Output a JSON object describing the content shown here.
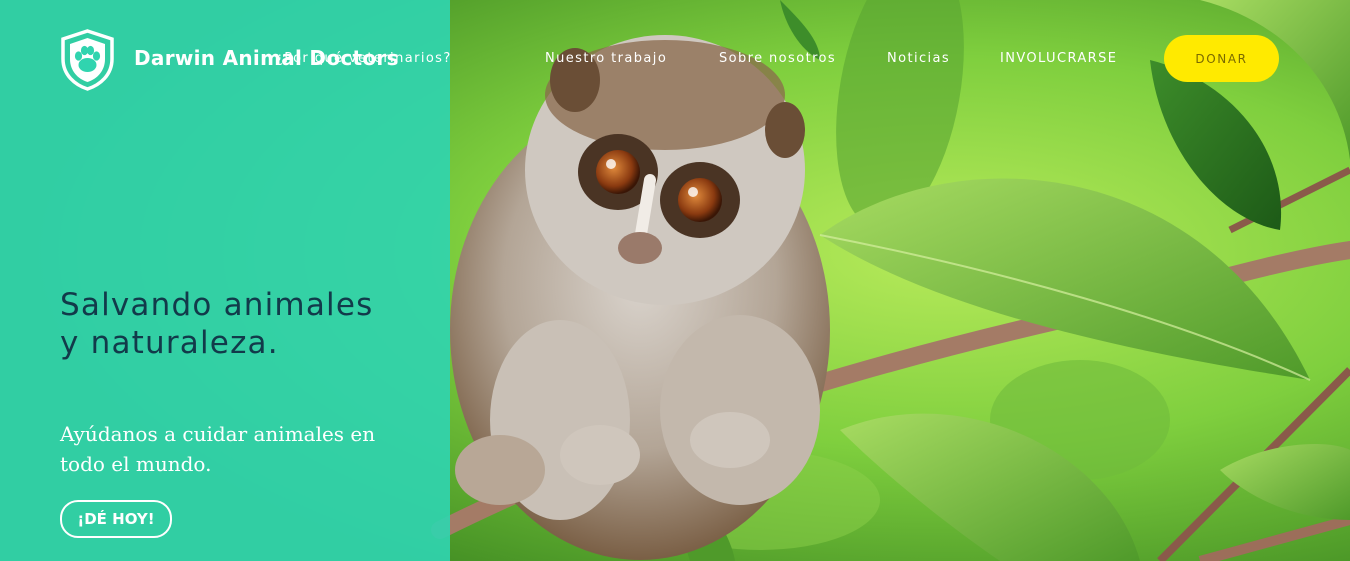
{
  "brand": {
    "name": "Darwin Animal Doctors",
    "logo_icon": "paw-shield-icon"
  },
  "nav": {
    "items": [
      {
        "label": "¿Por qué veterinarios?"
      },
      {
        "label": "Nuestro trabajo"
      },
      {
        "label": "Sobre nosotros"
      },
      {
        "label": "Noticias"
      },
      {
        "label": "INVOLUCRARSE"
      }
    ],
    "donate_label": "DONAR"
  },
  "hero": {
    "headline": "Salvando animales y naturaleza.",
    "subtitle": "Ayúdanos a cuidar animales en todo el mundo.",
    "cta_label": "¡DÉ HOY!",
    "image_subject": "slow loris on a branch among green leaves"
  },
  "colors": {
    "panel_teal": "#30d4af",
    "headline_navy": "#123a4a",
    "donate_yellow": "#ffea00",
    "white": "#ffffff"
  }
}
